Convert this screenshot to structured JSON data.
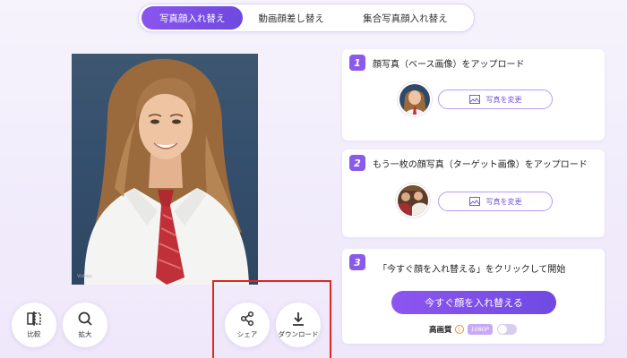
{
  "tabs": [
    {
      "label": "写真顔入れ替え",
      "active": true
    },
    {
      "label": "動画顔差し替え",
      "active": false
    },
    {
      "label": "集合写真顔入れ替え",
      "active": false
    }
  ],
  "photo": {
    "watermark": "Vidnoz"
  },
  "tools": {
    "compare": "比較",
    "zoom": "拡大",
    "share": "シェア",
    "download": "ダウンロード"
  },
  "steps": [
    {
      "number": "1",
      "title": "顔写真（ベース画像）をアップロード",
      "button": "写真を変更"
    },
    {
      "number": "2",
      "title": "もう一枚の顔写真（ターゲット画像）をアップロード",
      "button": "写真を変更"
    },
    {
      "number": "3",
      "title": "「今すぐ顔を入れ替える」をクリックして開始",
      "button": "今すぐ顔を入れ替える"
    }
  ],
  "quality": {
    "label": "高画質",
    "info": "i",
    "badge": "1080P",
    "enabled": false
  },
  "colors": {
    "accent": "#7c52ea",
    "highlight": "#e0261d"
  }
}
